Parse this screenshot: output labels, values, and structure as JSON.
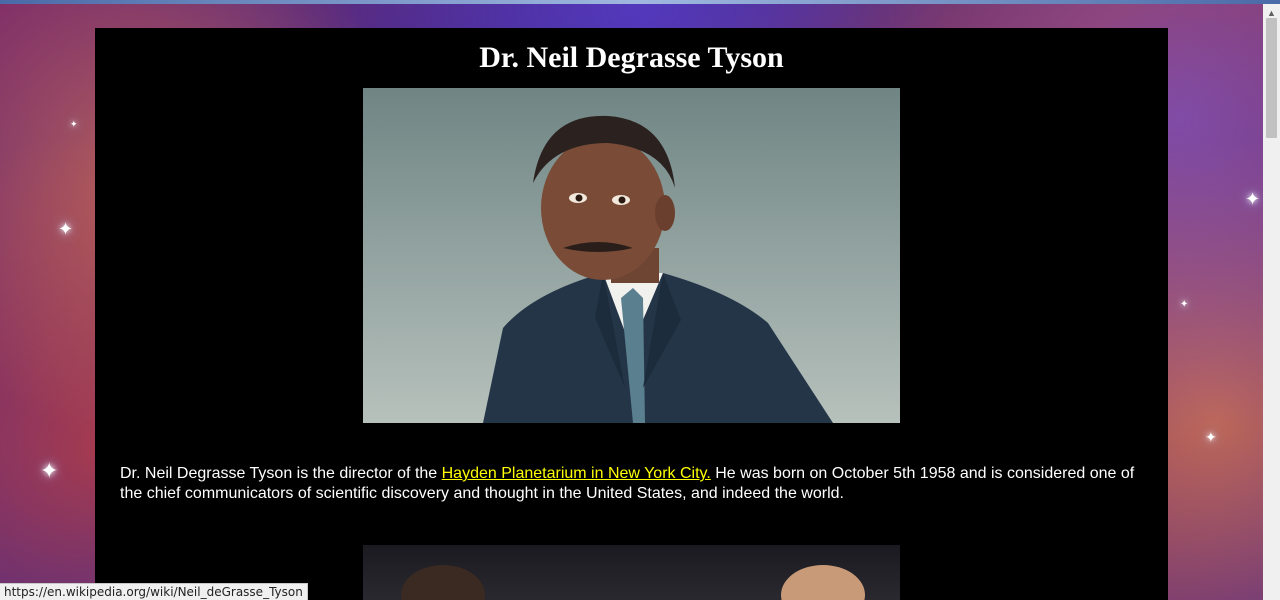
{
  "page": {
    "title": "Dr. Neil Degrasse Tyson",
    "bio_before": "Dr. Neil Degrasse Tyson is the director of the ",
    "link_text": "Hayden Planetarium in New York City.",
    "bio_after": " He was born on October 5th 1958 and is considered one of the chief communicators of scientific discovery and thought in the United States, and indeed the world."
  },
  "status_bar": {
    "url": "https://en.wikipedia.org/wiki/Neil_deGrasse_Tyson"
  },
  "colors": {
    "content_background": "#000000",
    "heading_text": "#ffffff",
    "link": "#ffff00"
  }
}
